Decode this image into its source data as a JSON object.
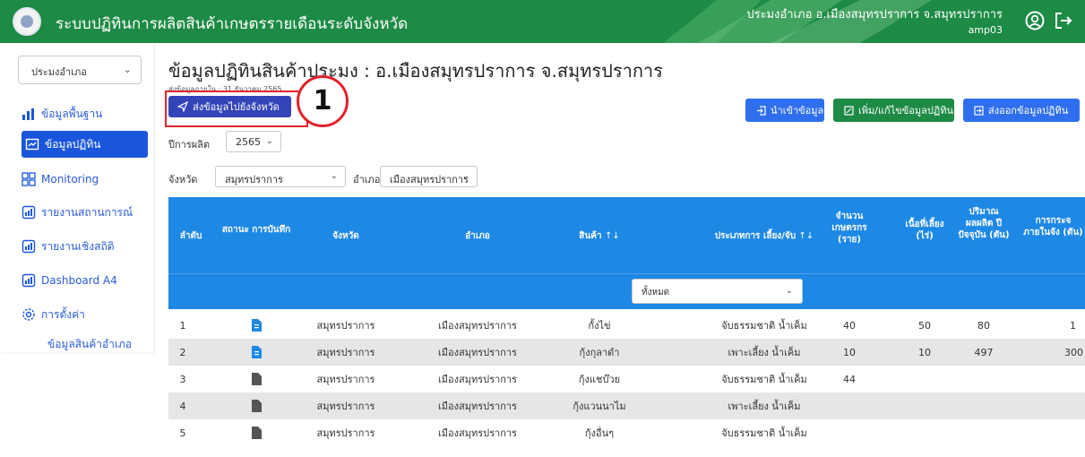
{
  "header": {
    "title": "ระบบปฏิทินการผลิตสินค้าเกษตรรายเดือนระดับจังหวัด",
    "user_role": "ประมงอำเภอ อ.เมืองสมุทรปราการ จ.สมุทรปราการ",
    "user_name": "amp03",
    "brand_color": "#1d8a45"
  },
  "sidebar": {
    "selector_value": "ประมงอำเภอ",
    "items": [
      {
        "label": "ข้อมูลพื้นฐาน",
        "icon": "bar-chart-icon",
        "active": false
      },
      {
        "label": "ข้อมูลปฏิทิน",
        "icon": "calendar-chart-icon",
        "active": true
      },
      {
        "label": "Monitoring",
        "icon": "grid-icon",
        "active": false
      },
      {
        "label": "รายงานสถานการณ์",
        "icon": "report-chart-icon",
        "active": false
      },
      {
        "label": "รายงานเชิงสถิติ",
        "icon": "report-chart-icon",
        "active": false
      },
      {
        "label": "Dashboard A4",
        "icon": "report-chart-icon",
        "active": false
      },
      {
        "label": "การตั้งค่า",
        "icon": "gear-icon",
        "active": false
      }
    ],
    "sub_item": "ข้อมูลสินค้าอำเภอ"
  },
  "main": {
    "title": "ข้อมูลปฏิทินสินค้าประมง : อ.เมืองสมุทรปราการ จ.สมุทรปราการ",
    "send_deadline": "ส่งข้อมูลภายใน : 31 ธันวาคม 2565",
    "send_button": "ส่งข้อมูลไปยังจังหวัด",
    "step_number": "1",
    "import_button": "นำเข้าข้อมูล",
    "edit_button": "เพิ่ม/แก้ไขข้อมูลปฏิทิน",
    "export_button": "ส่งออกข้อมูลปฏิทิน",
    "year_label": "ปีการผลิต",
    "year_value": "2565",
    "province_label": "จังหวัด",
    "province_value": "สมุทรปราการ",
    "district_label": "อำเภอ",
    "district_value": "เมืองสมุทรปราการ"
  },
  "table": {
    "headers": {
      "index": "ลำดับ",
      "status": "สถานะ การบันทึก",
      "province": "จังหวัด",
      "district": "อำเภอ",
      "product": "สินค้า",
      "type": "ประเภทการ เลี้ยง/จับ",
      "farmers": "จำนวน เกษตรกร (ราย)",
      "area": "เนื้อที่เลี้ยง (ไร่)",
      "production": "ปริมาณ ผลผลิต ปีปัจจุบัน (ตัน)",
      "distribution": "การกระจ ภายในจัง (ตัน)"
    },
    "sort_symbol": "↑↓",
    "type_filter": "ทั้งหมด",
    "rows": [
      {
        "no": "1",
        "status": "saved",
        "province": "สมุทรปราการ",
        "district": "เมืองสมุทรปราการ",
        "product": "กั้งไข่",
        "type": "จับธรรมชาติ น้ำเค็ม",
        "farmers": "40",
        "area": "50",
        "production": "80",
        "distribution": "1"
      },
      {
        "no": "2",
        "status": "saved",
        "province": "สมุทรปราการ",
        "district": "เมืองสมุทรปราการ",
        "product": "กุ้งกุลาดำ",
        "type": "เพาะเลี้ยง น้ำเค็ม",
        "farmers": "10",
        "area": "10",
        "production": "497",
        "distribution": "300"
      },
      {
        "no": "3",
        "status": "draft",
        "province": "สมุทรปราการ",
        "district": "เมืองสมุทรปราการ",
        "product": "กุ้งแชบ๊วย",
        "type": "จับธรรมชาติ น้ำเค็ม",
        "farmers": "44",
        "area": "",
        "production": "",
        "distribution": ""
      },
      {
        "no": "4",
        "status": "draft",
        "province": "สมุทรปราการ",
        "district": "เมืองสมุทรปราการ",
        "product": "กุ้งแวนนาไม",
        "type": "เพาะเลี้ยง น้ำเค็ม",
        "farmers": "",
        "area": "",
        "production": "",
        "distribution": ""
      },
      {
        "no": "5",
        "status": "draft",
        "province": "สมุทรปราการ",
        "district": "เมืองสมุทรปราการ",
        "product": "กุ้งอื่นๆ",
        "type": "จับธรรมชาติ น้ำเค็ม",
        "farmers": "",
        "area": "",
        "production": "",
        "distribution": ""
      }
    ]
  },
  "colors": {
    "accent_blue": "#1a56db",
    "table_header": "#1e88e5",
    "highlight": "#e0232d",
    "saved_status": "#1e88e5",
    "draft_status": "#555555"
  }
}
